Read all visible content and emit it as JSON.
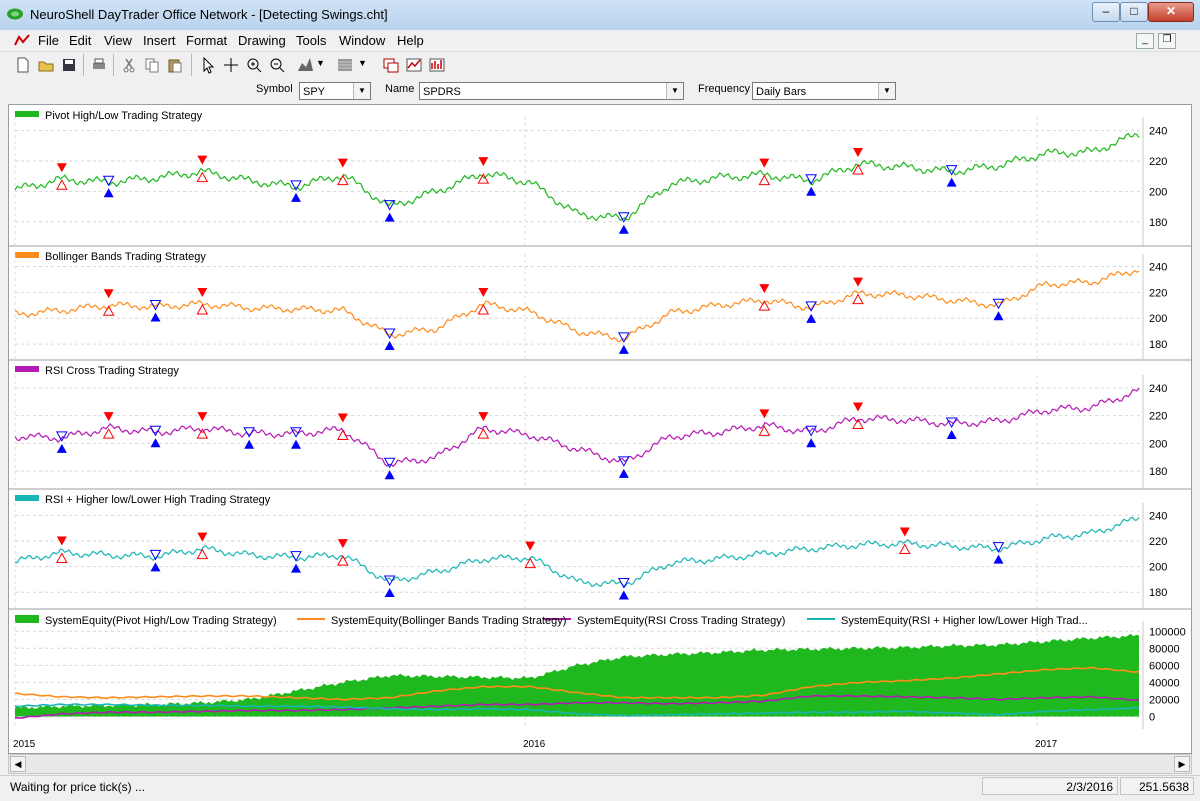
{
  "window": {
    "title": "NeuroShell DayTrader Office Network - [Detecting Swings.cht]"
  },
  "menu": [
    "File",
    "Edit",
    "View",
    "Insert",
    "Format",
    "Drawing",
    "Tools",
    "Window",
    "Help"
  ],
  "toolbar": {
    "buttons": [
      "new-icon",
      "open-icon",
      "save-icon",
      "print-icon",
      "cut-icon",
      "copy-icon",
      "paste-icon",
      "pointer-icon",
      "crosshair-icon",
      "zoom-in-icon",
      "zoom-out-icon",
      "chart-style-icon",
      "pattern-icon",
      "indicator-icon",
      "optimize-icon",
      "analysis-icon"
    ]
  },
  "params": {
    "symbol_label": "Symbol",
    "symbol_value": "SPY",
    "name_label": "Name",
    "name_value": "SPDRS",
    "frequency_label": "Frequency",
    "frequency_value": "Daily Bars"
  },
  "colors": {
    "green": "#1fb81f",
    "orange": "#ff8c1a",
    "purple": "#b41ab4",
    "teal": "#19b4b4",
    "buy": "#0000ff",
    "sell": "#ff0000"
  },
  "panes": [
    {
      "title": "Pivot High/Low Trading Strategy",
      "color": "#1fb81f",
      "yticks": [
        "240",
        "220",
        "200",
        "180"
      ]
    },
    {
      "title": "Bollinger Bands Trading Strategy",
      "color": "#ff8c1a",
      "yticks": [
        "240",
        "220",
        "200",
        "180"
      ]
    },
    {
      "title": "RSI Cross Trading Strategy",
      "color": "#b41ab4",
      "yticks": [
        "240",
        "220",
        "200",
        "180"
      ]
    },
    {
      "title": "RSI + Higher low/Lower High Trading Strategy",
      "color": "#19b4b4",
      "yticks": [
        "240",
        "220",
        "200",
        "180"
      ]
    }
  ],
  "equity": {
    "legend": [
      {
        "label": "SystemEquity(Pivot High/Low Trading Strategy)",
        "color": "#1fb81f"
      },
      {
        "label": "SystemEquity(Bollinger Bands Trading Strategy)",
        "color": "#ff8c1a"
      },
      {
        "label": "SystemEquity(RSI Cross Trading Strategy)",
        "color": "#b41ab4"
      },
      {
        "label": "SystemEquity(RSI + Higher low/Lower High Trad...",
        "color": "#19b4b4"
      }
    ],
    "yticks": [
      "100000",
      "80000",
      "60000",
      "40000",
      "20000",
      "0"
    ]
  },
  "xaxis": [
    "2015",
    "2016",
    "2017"
  ],
  "status": {
    "message": "Waiting for price tick(s) ...",
    "date": "2/3/2016",
    "value": "251.5638"
  },
  "chart_data": [
    {
      "type": "line",
      "title": "Pivot High/Low Trading Strategy",
      "x": [
        "2015",
        "2016",
        "2017"
      ],
      "ylim": [
        170,
        245
      ],
      "series": [
        {
          "name": "Pivot High/Low Trading Strategy",
          "values": [
            201,
            208,
            206,
            209,
            213,
            207,
            203,
            211,
            190,
            200,
            212,
            206,
            185,
            182,
            205,
            209,
            211,
            207,
            218,
            216,
            213,
            217,
            225,
            226,
            238
          ]
        }
      ]
    },
    {
      "type": "line",
      "title": "Bollinger Bands Trading Strategy",
      "x": [
        "2015",
        "2016",
        "2017"
      ],
      "ylim": [
        170,
        245
      ],
      "series": [
        {
          "name": "Bollinger Bands Trading Strategy",
          "values": [
            203,
            206,
            210,
            209,
            211,
            208,
            207,
            206,
            187,
            192,
            211,
            205,
            190,
            184,
            204,
            210,
            214,
            208,
            219,
            218,
            214,
            210,
            226,
            228,
            238
          ]
        }
      ]
    },
    {
      "type": "line",
      "title": "RSI Cross Trading Strategy",
      "x": [
        "2015",
        "2016",
        "2017"
      ],
      "ylim": [
        170,
        245
      ],
      "series": [
        {
          "name": "RSI Cross Trading Strategy",
          "values": [
            205,
            204,
            211,
            208,
            211,
            207,
            207,
            210,
            185,
            190,
            211,
            206,
            196,
            186,
            205,
            208,
            213,
            208,
            218,
            217,
            214,
            216,
            224,
            226,
            238
          ]
        }
      ]
    },
    {
      "type": "line",
      "title": "RSI + Higher low/Lower High Trading Strategy",
      "x": [
        "2015",
        "2016",
        "2017"
      ],
      "ylim": [
        170,
        245
      ],
      "series": [
        {
          "name": "RSI + Higher low/Lower High Trading Strategy",
          "values": [
            204,
            211,
            209,
            208,
            214,
            209,
            207,
            209,
            188,
            196,
            206,
            207,
            188,
            186,
            203,
            206,
            210,
            214,
            217,
            218,
            216,
            214,
            222,
            226,
            238
          ]
        }
      ]
    },
    {
      "type": "area",
      "title": "",
      "x": [
        "2015",
        "2016",
        "2017"
      ],
      "ylim": [
        -10000,
        105000
      ],
      "series": [
        {
          "name": "SystemEquity(Pivot High/Low Trading Strategy)",
          "values": [
            10000,
            12000,
            13000,
            14000,
            16000,
            20000,
            30000,
            40000,
            48000,
            47000,
            46000,
            45000,
            60000,
            70000,
            73000,
            75000,
            78000,
            79000,
            80000,
            81000,
            83000,
            84000,
            88000,
            92000,
            95000
          ]
        },
        {
          "name": "SystemEquity(Bollinger Bands Trading Strategy)",
          "values": [
            27000,
            23000,
            22000,
            23000,
            24000,
            24000,
            22000,
            20000,
            22000,
            30000,
            35000,
            35000,
            28000,
            22000,
            22000,
            22000,
            25000,
            35000,
            40000,
            42000,
            45000,
            50000,
            55000,
            57000,
            52000
          ]
        },
        {
          "name": "SystemEquity(RSI Cross Trading Strategy)",
          "values": [
            -2000,
            3000,
            5000,
            5000,
            6000,
            7000,
            7000,
            8000,
            10000,
            12000,
            14000,
            14000,
            16000,
            16000,
            15000,
            16000,
            18000,
            24000,
            24000,
            23000,
            22000,
            20000,
            22000,
            23000,
            19000
          ]
        },
        {
          "name": "SystemEquity(RSI + Higher low/Lower High Trad...",
          "values": [
            12000,
            14000,
            14000,
            13000,
            13000,
            12000,
            12000,
            11000,
            9000,
            8000,
            9000,
            8000,
            3000,
            1000,
            2000,
            3000,
            4000,
            5000,
            5000,
            6000,
            4000,
            2000,
            6000,
            8000,
            10000
          ]
        }
      ]
    }
  ]
}
